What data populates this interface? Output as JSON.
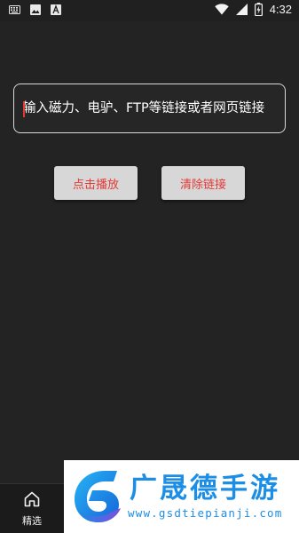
{
  "status_bar": {
    "time": "4:32",
    "left_icons": [
      "keyboard-icon",
      "image-icon",
      "font-icon"
    ],
    "right_icons": [
      "wifi-icon",
      "signal-icon",
      "battery-icon"
    ]
  },
  "link_input": {
    "placeholder": "输入磁力、电驴、FTP等链接或者网页链接",
    "value": ""
  },
  "buttons": {
    "play_label": "点击播放",
    "clear_label": "清除链接"
  },
  "bottom_nav": {
    "items": [
      {
        "label": "精选",
        "icon": "home-icon"
      }
    ]
  },
  "watermark": {
    "title": "广晟德手游",
    "url": "www.gsdtiepianji.com"
  },
  "colors": {
    "background": "#232323",
    "button_bg": "#d7d7d7",
    "button_text": "#e53935",
    "watermark_blue": "#1d8ee6"
  }
}
